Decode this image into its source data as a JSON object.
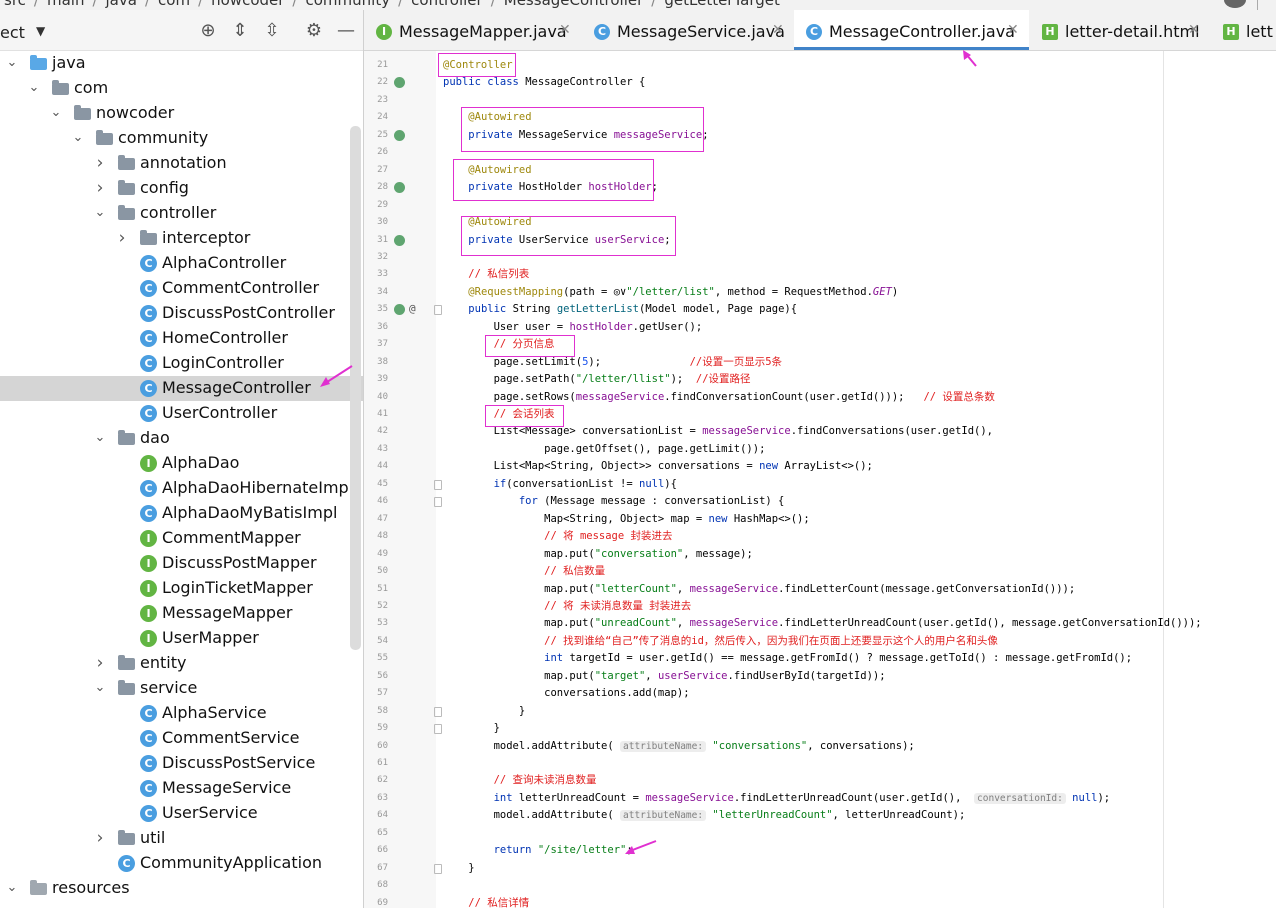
{
  "breadcrumb": {
    "items": [
      "src",
      "main",
      "java",
      "com",
      "nowcoder",
      "community",
      "controller",
      "MessageController",
      "getLetterTarget"
    ]
  },
  "project_panel": {
    "title": "ect",
    "tree": [
      {
        "label": "java",
        "indent": 0,
        "arrow": "v",
        "icon": "folder-java"
      },
      {
        "label": "com",
        "indent": 1,
        "arrow": "v",
        "icon": "package"
      },
      {
        "label": "nowcoder",
        "indent": 2,
        "arrow": "v",
        "icon": "package"
      },
      {
        "label": "community",
        "indent": 3,
        "arrow": "v",
        "icon": "package"
      },
      {
        "label": "annotation",
        "indent": 4,
        "arrow": ">",
        "icon": "package"
      },
      {
        "label": "config",
        "indent": 4,
        "arrow": ">",
        "icon": "package"
      },
      {
        "label": "controller",
        "indent": 4,
        "arrow": "v",
        "icon": "package"
      },
      {
        "label": "interceptor",
        "indent": 5,
        "arrow": ">",
        "icon": "package"
      },
      {
        "label": "AlphaController",
        "indent": 5,
        "arrow": "",
        "icon": "class"
      },
      {
        "label": "CommentController",
        "indent": 5,
        "arrow": "",
        "icon": "class"
      },
      {
        "label": "DiscussPostController",
        "indent": 5,
        "arrow": "",
        "icon": "class"
      },
      {
        "label": "HomeController",
        "indent": 5,
        "arrow": "",
        "icon": "class"
      },
      {
        "label": "LoginController",
        "indent": 5,
        "arrow": "",
        "icon": "class"
      },
      {
        "label": "MessageController",
        "indent": 5,
        "arrow": "",
        "icon": "class",
        "selected": true
      },
      {
        "label": "UserController",
        "indent": 5,
        "arrow": "",
        "icon": "class"
      },
      {
        "label": "dao",
        "indent": 4,
        "arrow": "v",
        "icon": "package"
      },
      {
        "label": "AlphaDao",
        "indent": 5,
        "arrow": "",
        "icon": "interface"
      },
      {
        "label": "AlphaDaoHibernateImpl",
        "indent": 5,
        "arrow": "",
        "icon": "class"
      },
      {
        "label": "AlphaDaoMyBatisImpl",
        "indent": 5,
        "arrow": "",
        "icon": "class"
      },
      {
        "label": "CommentMapper",
        "indent": 5,
        "arrow": "",
        "icon": "interface"
      },
      {
        "label": "DiscussPostMapper",
        "indent": 5,
        "arrow": "",
        "icon": "interface"
      },
      {
        "label": "LoginTicketMapper",
        "indent": 5,
        "arrow": "",
        "icon": "interface"
      },
      {
        "label": "MessageMapper",
        "indent": 5,
        "arrow": "",
        "icon": "interface"
      },
      {
        "label": "UserMapper",
        "indent": 5,
        "arrow": "",
        "icon": "interface"
      },
      {
        "label": "entity",
        "indent": 4,
        "arrow": ">",
        "icon": "package"
      },
      {
        "label": "service",
        "indent": 4,
        "arrow": "v",
        "icon": "package"
      },
      {
        "label": "AlphaService",
        "indent": 5,
        "arrow": "",
        "icon": "class"
      },
      {
        "label": "CommentService",
        "indent": 5,
        "arrow": "",
        "icon": "class"
      },
      {
        "label": "DiscussPostService",
        "indent": 5,
        "arrow": "",
        "icon": "class"
      },
      {
        "label": "MessageService",
        "indent": 5,
        "arrow": "",
        "icon": "class"
      },
      {
        "label": "UserService",
        "indent": 5,
        "arrow": "",
        "icon": "class"
      },
      {
        "label": "util",
        "indent": 4,
        "arrow": ">",
        "icon": "package"
      },
      {
        "label": "CommunityApplication",
        "indent": 4,
        "arrow": "",
        "icon": "app-class"
      },
      {
        "label": "resources",
        "indent": 0,
        "arrow": "v",
        "icon": "folder-resources"
      }
    ]
  },
  "tabs": [
    {
      "label": "MessageMapper.java",
      "icon": "interface",
      "active": false
    },
    {
      "label": "MessageService.java",
      "icon": "class",
      "active": false
    },
    {
      "label": "MessageController.java",
      "icon": "class",
      "active": true
    },
    {
      "label": "letter-detail.html",
      "icon": "html",
      "active": false
    },
    {
      "label": "lett",
      "icon": "html",
      "active": false
    }
  ],
  "editor": {
    "lines": [
      {
        "n": "21",
        "segs": [
          [
            "ann",
            "@Controller"
          ]
        ]
      },
      {
        "n": "22",
        "segs": [
          [
            "kw",
            "public class "
          ],
          [
            "",
            "MessageController {"
          ]
        ]
      },
      {
        "n": "23",
        "segs": []
      },
      {
        "n": "24",
        "segs": [
          [
            "",
            "    "
          ],
          [
            "ann",
            "@Autowired"
          ]
        ]
      },
      {
        "n": "25",
        "segs": [
          [
            "",
            "    "
          ],
          [
            "kw",
            "private "
          ],
          [
            "",
            "MessageService "
          ],
          [
            "fv",
            "messageService"
          ],
          [
            "",
            ";"
          ]
        ]
      },
      {
        "n": "26",
        "segs": []
      },
      {
        "n": "27",
        "segs": [
          [
            "",
            "    "
          ],
          [
            "ann",
            "@Autowired"
          ]
        ]
      },
      {
        "n": "28",
        "segs": [
          [
            "",
            "    "
          ],
          [
            "kw",
            "private "
          ],
          [
            "",
            "HostHolder "
          ],
          [
            "fv",
            "hostHolder"
          ],
          [
            "",
            ";"
          ]
        ]
      },
      {
        "n": "29",
        "segs": []
      },
      {
        "n": "30",
        "segs": [
          [
            "",
            "    "
          ],
          [
            "ann",
            "@Autowired"
          ]
        ]
      },
      {
        "n": "31",
        "segs": [
          [
            "",
            "    "
          ],
          [
            "kw",
            "private "
          ],
          [
            "",
            "UserService "
          ],
          [
            "fv",
            "userService"
          ],
          [
            "",
            ";"
          ]
        ]
      },
      {
        "n": "32",
        "segs": []
      },
      {
        "n": "33",
        "segs": [
          [
            "",
            "    "
          ],
          [
            "cm",
            "// 私信列表"
          ]
        ]
      },
      {
        "n": "34",
        "segs": [
          [
            "",
            "    "
          ],
          [
            "ann",
            "@RequestMapping"
          ],
          [
            "",
            "(path = ◎∨"
          ],
          [
            "str",
            "\"/letter/list\""
          ],
          [
            "",
            ", method = RequestMethod."
          ],
          [
            "cst",
            "GET"
          ],
          [
            "",
            ")"
          ]
        ]
      },
      {
        "n": "35",
        "segs": [
          [
            "",
            "    "
          ],
          [
            "kw",
            "public "
          ],
          [
            "",
            "String "
          ],
          [
            "fn",
            "getLetterList"
          ],
          [
            "",
            "(Model model, Page page){"
          ]
        ]
      },
      {
        "n": "36",
        "segs": [
          [
            "",
            "        User user = "
          ],
          [
            "fv",
            "hostHolder"
          ],
          [
            "",
            ".getUser();"
          ]
        ]
      },
      {
        "n": "37",
        "segs": [
          [
            "",
            "        "
          ],
          [
            "cm",
            "// 分页信息"
          ]
        ]
      },
      {
        "n": "38",
        "segs": [
          [
            "",
            "        page.setLimit("
          ],
          [
            "num",
            "5"
          ],
          [
            "",
            ");              "
          ],
          [
            "cm",
            "//设置一页显示5条"
          ]
        ]
      },
      {
        "n": "39",
        "segs": [
          [
            "",
            "        page.setPath("
          ],
          [
            "str",
            "\"/letter/llist\""
          ],
          [
            "",
            ");  "
          ],
          [
            "cm",
            "//设置路径"
          ]
        ]
      },
      {
        "n": "40",
        "segs": [
          [
            "",
            "        page.setRows("
          ],
          [
            "fv",
            "messageService"
          ],
          [
            "",
            ".findConversationCount(user.getId()));   "
          ],
          [
            "cm",
            "// 设置总条数"
          ]
        ]
      },
      {
        "n": "41",
        "segs": [
          [
            "",
            "        "
          ],
          [
            "cm",
            "// 会话列表"
          ]
        ]
      },
      {
        "n": "42",
        "segs": [
          [
            "",
            "        List<Message> conversationList = "
          ],
          [
            "fv",
            "messageService"
          ],
          [
            "",
            ".findConversations(user.getId(),"
          ]
        ]
      },
      {
        "n": "43",
        "segs": [
          [
            "",
            "                page.getOffset(), page.getLimit());"
          ]
        ]
      },
      {
        "n": "44",
        "segs": [
          [
            "",
            "        List<Map<String, Object>> conversations = "
          ],
          [
            "kw",
            "new "
          ],
          [
            "",
            "ArrayList<>();"
          ]
        ]
      },
      {
        "n": "45",
        "segs": [
          [
            "",
            "        "
          ],
          [
            "kw",
            "if"
          ],
          [
            "",
            "(conversationList != "
          ],
          [
            "kw",
            "null"
          ],
          [
            "",
            "){"
          ]
        ]
      },
      {
        "n": "46",
        "segs": [
          [
            "",
            "            "
          ],
          [
            "kw",
            "for "
          ],
          [
            "",
            "(Message message : conversationList) {"
          ]
        ]
      },
      {
        "n": "47",
        "segs": [
          [
            "",
            "                Map<String, Object> map = "
          ],
          [
            "kw",
            "new "
          ],
          [
            "",
            "HashMap<>();"
          ]
        ]
      },
      {
        "n": "48",
        "segs": [
          [
            "",
            "                "
          ],
          [
            "cm",
            "// 将 message 封装进去"
          ]
        ]
      },
      {
        "n": "49",
        "segs": [
          [
            "",
            "                map.put("
          ],
          [
            "str",
            "\"conversation\""
          ],
          [
            "",
            ", message);"
          ]
        ]
      },
      {
        "n": "50",
        "segs": [
          [
            "",
            "                "
          ],
          [
            "cm",
            "// 私信数量"
          ]
        ]
      },
      {
        "n": "51",
        "segs": [
          [
            "",
            "                map.put("
          ],
          [
            "str",
            "\"letterCount\""
          ],
          [
            "",
            ", "
          ],
          [
            "fv",
            "messageService"
          ],
          [
            "",
            ".findLetterCount(message.getConversationId()));"
          ]
        ]
      },
      {
        "n": "52",
        "segs": [
          [
            "",
            "                "
          ],
          [
            "cm",
            "// 将 未读消息数量 封装进去"
          ]
        ]
      },
      {
        "n": "53",
        "segs": [
          [
            "",
            "                map.put("
          ],
          [
            "str",
            "\"unreadCount\""
          ],
          [
            "",
            ", "
          ],
          [
            "fv",
            "messageService"
          ],
          [
            "",
            ".findLetterUnreadCount(user.getId(), message.getConversationId()));"
          ]
        ]
      },
      {
        "n": "54",
        "segs": [
          [
            "",
            "                "
          ],
          [
            "cm",
            "// 找到谁给“自己”传了消息的id，然后传入，因为我们在页面上还要显示这个人的用户名和头像"
          ]
        ]
      },
      {
        "n": "55",
        "segs": [
          [
            "",
            "                "
          ],
          [
            "kw",
            "int "
          ],
          [
            "",
            "targetId = user.getId() == message.getFromId() ? message.getToId() : message.getFromId();"
          ]
        ]
      },
      {
        "n": "56",
        "segs": [
          [
            "",
            "                map.put("
          ],
          [
            "str",
            "\"target\""
          ],
          [
            "",
            ", "
          ],
          [
            "fv",
            "userService"
          ],
          [
            "",
            ".findUserById(targetId));"
          ]
        ]
      },
      {
        "n": "57",
        "segs": [
          [
            "",
            "                conversations.add(map);"
          ]
        ]
      },
      {
        "n": "58",
        "segs": [
          [
            "",
            "            }"
          ]
        ]
      },
      {
        "n": "59",
        "segs": [
          [
            "",
            "        }"
          ]
        ]
      },
      {
        "n": "60",
        "segs": [
          [
            "",
            "        model.addAttribute( "
          ],
          [
            "hint",
            "attributeName:"
          ],
          [
            "",
            " "
          ],
          [
            "str",
            "\"conversations\""
          ],
          [
            "",
            ", conversations);"
          ]
        ]
      },
      {
        "n": "61",
        "segs": []
      },
      {
        "n": "62",
        "segs": [
          [
            "",
            "        "
          ],
          [
            "cm",
            "// 查询未读消息数量"
          ]
        ]
      },
      {
        "n": "63",
        "segs": [
          [
            "",
            "        "
          ],
          [
            "kw",
            "int "
          ],
          [
            "",
            "letterUnreadCount = "
          ],
          [
            "fv",
            "messageService"
          ],
          [
            "",
            ".findLetterUnreadCount(user.getId(),  "
          ],
          [
            "hint",
            "conversationId:"
          ],
          [
            "",
            " "
          ],
          [
            "kw",
            "null"
          ],
          [
            "",
            ");"
          ]
        ]
      },
      {
        "n": "64",
        "segs": [
          [
            "",
            "        model.addAttribute( "
          ],
          [
            "hint",
            "attributeName:"
          ],
          [
            "",
            " "
          ],
          [
            "str",
            "\"letterUnreadCount\""
          ],
          [
            "",
            ", letterUnreadCount);"
          ]
        ]
      },
      {
        "n": "65",
        "segs": []
      },
      {
        "n": "66",
        "segs": [
          [
            "",
            "        "
          ],
          [
            "kw",
            "return "
          ],
          [
            "str",
            "\"/site/letter\""
          ],
          [
            "",
            ";"
          ]
        ]
      },
      {
        "n": "67",
        "segs": [
          [
            "",
            "    }"
          ]
        ]
      },
      {
        "n": "68",
        "segs": []
      },
      {
        "n": "69",
        "segs": [
          [
            "",
            "    "
          ],
          [
            "cm",
            "// 私信详情"
          ]
        ]
      }
    ]
  },
  "colors": {
    "accent": "#4083c9",
    "highlight_box": "#e030d0",
    "selection": "#d5d5d5"
  }
}
